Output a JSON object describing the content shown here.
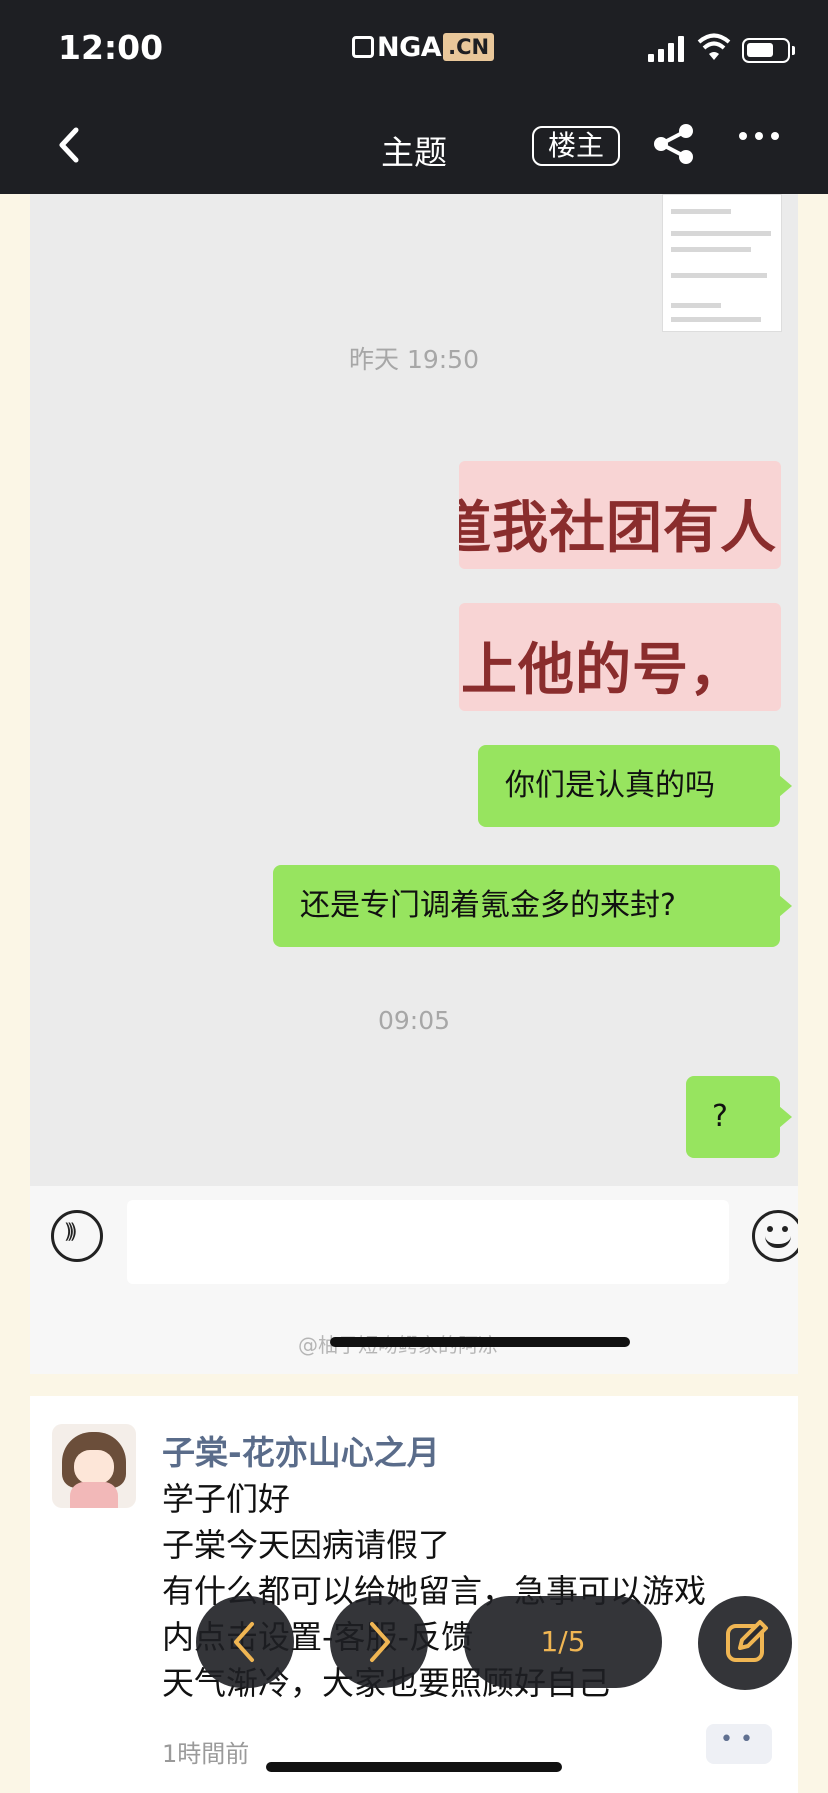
{
  "status_bar": {
    "time": "12:00"
  },
  "nav": {
    "logo_main": "NGA",
    "logo_cn": ".CN",
    "title": "主题",
    "op_button": "楼主"
  },
  "chat_screenshot": {
    "timestamp_1": "昨天 19:50",
    "pink_1": "道我社团有人",
    "pink_2": "上他的号，",
    "msg_1": "你们是认真的吗",
    "msg_2": "还是专门调着氪金多的来封?",
    "timestamp_2": "09:05",
    "msg_3": "?",
    "watermark": "@柚子短吻鳄家的阿凉"
  },
  "post": {
    "username": "子棠-花亦山心之月",
    "lines": [
      "学子们好",
      "子棠今天因病请假了",
      "有什么都可以给她留言，急事可以游戏",
      "内点击设置-客服-反馈",
      "天气渐冷，大家也要照顾好自己"
    ],
    "time_ago": "1時間前"
  },
  "pager": {
    "label": "1/5"
  },
  "colors": {
    "bar": "#1e1f23",
    "accent": "#f0b653",
    "bubble_green": "#97e45f",
    "username": "#5a6c8a",
    "page_bg": "#fbf6e6"
  },
  "icons": [
    "back-icon",
    "share-icon",
    "more-icon",
    "voice-icon",
    "emoji-icon",
    "chevron-left-icon",
    "chevron-right-icon",
    "edit-icon"
  ]
}
